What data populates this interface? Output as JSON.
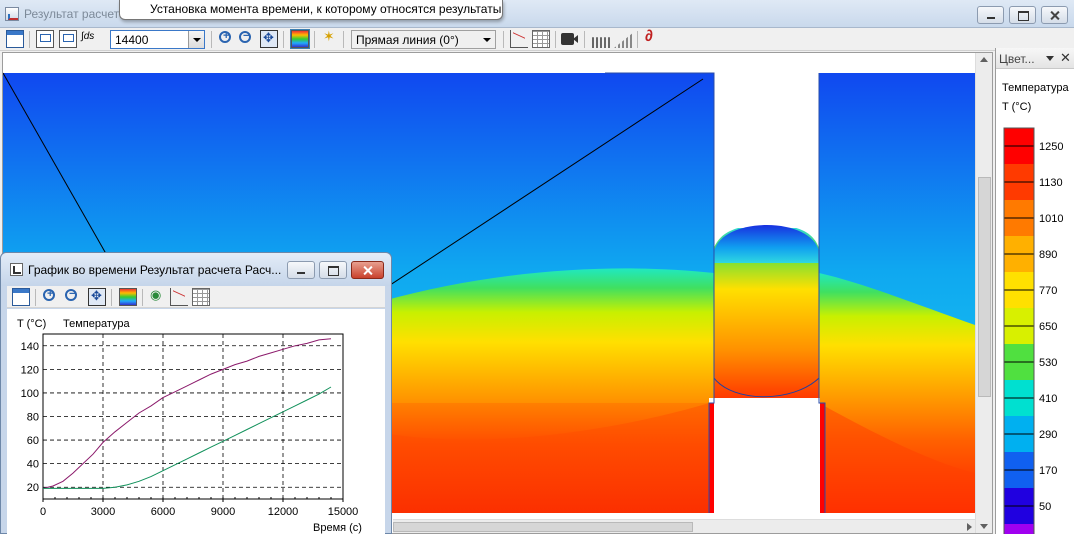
{
  "window": {
    "title": "Результат расчета"
  },
  "tooltip": {
    "text": "Установка момента времени, к которому относятся результаты"
  },
  "toolbar": {
    "time_value": "14400",
    "line_mode": "Прямая линия (0°)"
  },
  "legend": {
    "panel_title": "Цвет...",
    "quantity": "Температура",
    "unit": "T (°C)",
    "ticks": [
      "1250",
      "1130",
      "1010",
      "890",
      "770",
      "650",
      "530",
      "410",
      "290",
      "170",
      "50"
    ],
    "colors": [
      "#ff0000",
      "#ff3a00",
      "#ff7a00",
      "#ffb000",
      "#ffe000",
      "#d8f000",
      "#50e040",
      "#00e0d0",
      "#00b0f0",
      "#1060f0",
      "#2000e0",
      "#a000f0"
    ]
  },
  "subwindow": {
    "title": "График во времени Результат расчета Расч...",
    "chart": {
      "ylabel": "T (°C)",
      "series_label": "Температура",
      "xlabel": "Время (с)"
    }
  },
  "chart_data": {
    "type": "line",
    "ylabel": "T (°C)",
    "xlabel": "Время (с)",
    "xlim": [
      0,
      15000
    ],
    "ylim": [
      10,
      150
    ],
    "x_ticks": [
      0,
      3000,
      6000,
      9000,
      12000,
      15000
    ],
    "y_ticks": [
      20,
      40,
      60,
      80,
      100,
      120,
      140
    ],
    "grid": true,
    "series": [
      {
        "name": "Температура",
        "color": "#8b1a6b",
        "x": [
          0,
          500,
          1000,
          1500,
          2000,
          2500,
          3000,
          3600,
          4200,
          4800,
          5400,
          6000,
          6600,
          7200,
          7800,
          8400,
          9000,
          9600,
          10200,
          10800,
          11400,
          12000,
          12600,
          13200,
          13800,
          14400
        ],
        "y": [
          19,
          21,
          25,
          32,
          40,
          48,
          58,
          67,
          75,
          83,
          89,
          96,
          101,
          106,
          111,
          116,
          120,
          124,
          127,
          131,
          134,
          137,
          140,
          142,
          145,
          146
        ]
      },
      {
        "color": "#10905a",
        "x": [
          0,
          1000,
          2000,
          3000,
          3600,
          4200,
          4800,
          5400,
          6000,
          6600,
          7200,
          7800,
          8400,
          9000,
          9600,
          10200,
          10800,
          11400,
          12000,
          12600,
          13200,
          13800,
          14400
        ],
        "y": [
          19,
          19,
          19,
          19,
          20,
          22,
          25,
          29,
          34,
          39,
          44,
          49,
          54,
          59,
          64,
          69,
          74,
          79,
          84,
          89,
          94,
          99,
          105
        ]
      }
    ]
  }
}
